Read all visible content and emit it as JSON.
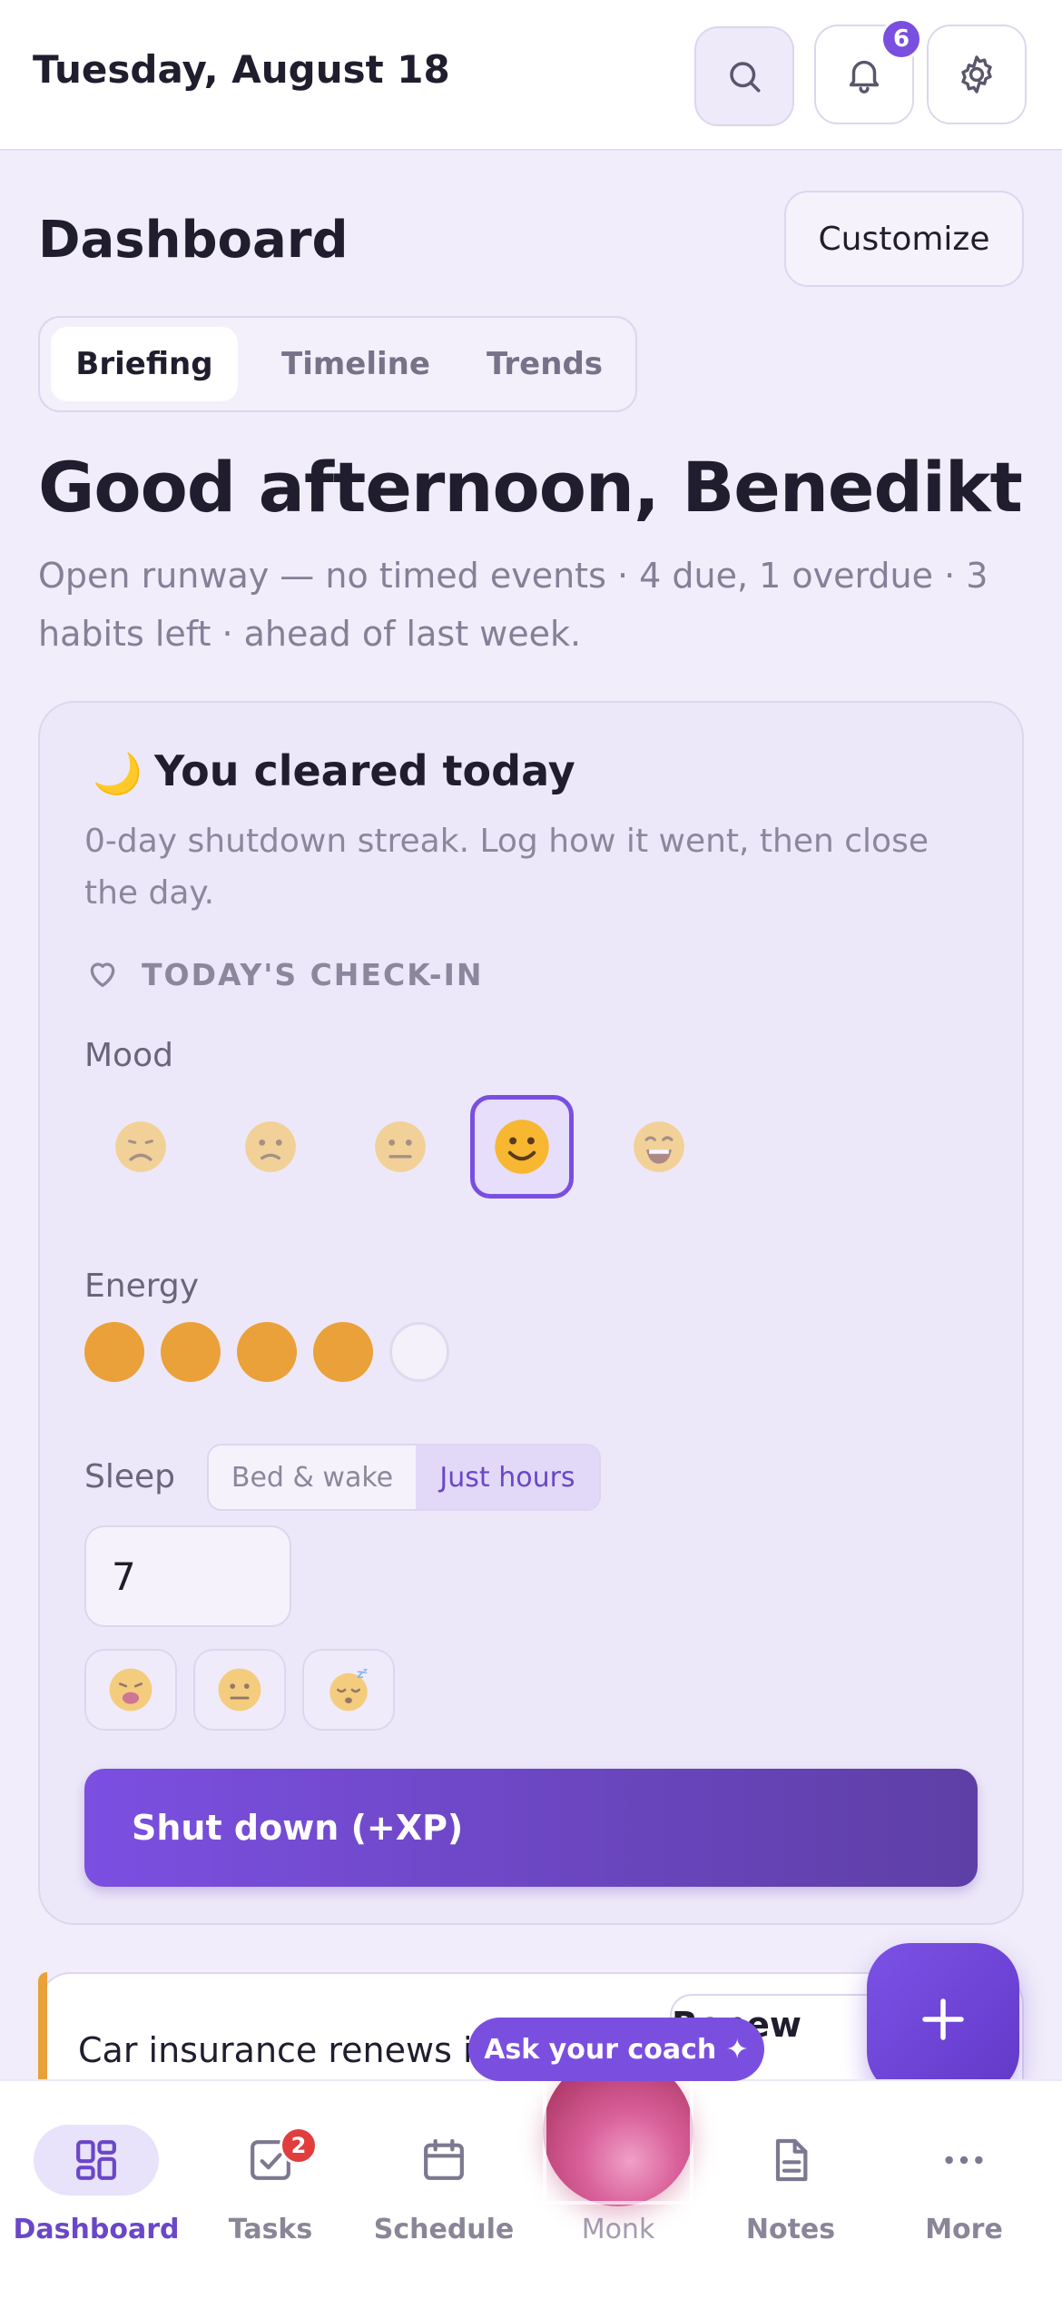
{
  "header": {
    "date": "Tuesday, August 18",
    "notification_count": "6"
  },
  "dashboard": {
    "title": "Dashboard",
    "customize_label": "Customize",
    "tabs": [
      {
        "label": "Briefing",
        "active": true
      },
      {
        "label": "Timeline",
        "active": false
      },
      {
        "label": "Trends",
        "active": false
      }
    ]
  },
  "briefing": {
    "greeting": "Good afternoon, Benedikt",
    "summary": "Open runway — no timed events · 4 due, 1 overdue · 3 habits left · ahead of last week."
  },
  "shutdown_card": {
    "icon": "moon-icon",
    "title": "You cleared today",
    "subtitle": "0-day shutdown streak. Log how it went, then close the day.",
    "checkin_label": "TODAY'S CHECK-IN",
    "mood_label": "Mood",
    "moods": [
      "very-sad",
      "sad",
      "neutral",
      "happy",
      "very-happy"
    ],
    "selected_mood_index": 3,
    "energy_label": "Energy",
    "energy_level": 4,
    "energy_max": 5,
    "sleep_label": "Sleep",
    "sleep_modes": [
      "Bed & wake",
      "Just hours"
    ],
    "sleep_mode_selected": "Just hours",
    "sleep_hours": "7",
    "sleep_quality_chips": [
      "tired-face",
      "neutral-face",
      "sleeping-face"
    ],
    "shutdown_button": "Shut down (+XP)"
  },
  "reminder": {
    "text": "Car insurance renews in",
    "action": "Renew now"
  },
  "coach": {
    "pill_label": "Ask your coach ✦"
  },
  "bottom_nav": {
    "items": [
      {
        "label": "Dashboard",
        "icon": "grid-icon",
        "active": true
      },
      {
        "label": "Tasks",
        "icon": "checkbox-icon",
        "badge": "2"
      },
      {
        "label": "Schedule",
        "icon": "calendar-icon"
      },
      {
        "label": "Monk",
        "icon": "orb-icon"
      },
      {
        "label": "Notes",
        "icon": "document-icon"
      },
      {
        "label": "More",
        "icon": "ellipsis-icon"
      }
    ]
  },
  "colors": {
    "accent": "#7a4fe0",
    "energy": "#eaa13a",
    "background": "#f1edfa",
    "badge_red": "#e23d3d"
  }
}
